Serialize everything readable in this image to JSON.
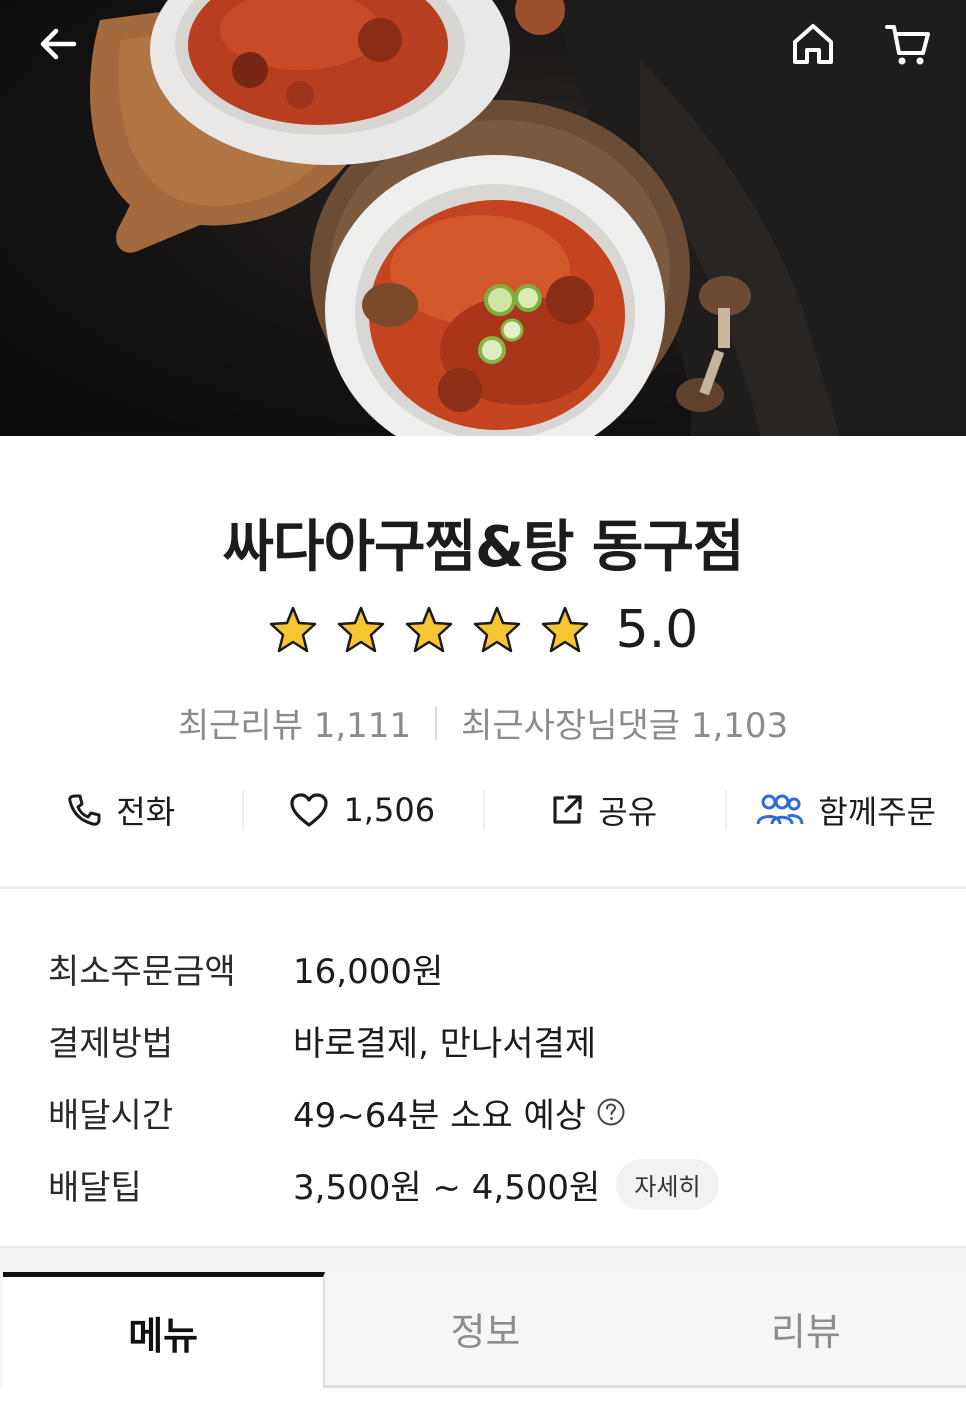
{
  "header": {
    "back_icon": "arrow-left-icon",
    "home_icon": "home-icon",
    "cart_icon": "cart-icon"
  },
  "store": {
    "name": "싸다아구찜&탕 동구점",
    "rating": "5.0",
    "star_count": 5,
    "recent_reviews_label": "최근리뷰 1,111",
    "owner_replies_label": "최근사장님댓글 1,103"
  },
  "actions": {
    "call": {
      "label": "전화",
      "icon": "phone-icon"
    },
    "like": {
      "label": "1,506",
      "icon": "heart-icon"
    },
    "share": {
      "label": "공유",
      "icon": "share-icon"
    },
    "group_order": {
      "label": "함께주문",
      "icon": "people-icon",
      "color": "#2f6bd8"
    }
  },
  "details": [
    {
      "label": "최소주문금액",
      "value": "16,000원"
    },
    {
      "label": "결제방법",
      "value": "바로결제, 만나서결제"
    },
    {
      "label": "배달시간",
      "value": "49~64분 소요 예상"
    },
    {
      "label": "배달팁",
      "value": "3,500원 ~ 4,500원",
      "chip": "자세히"
    }
  ],
  "tabs": [
    {
      "label": "메뉴",
      "active": true
    },
    {
      "label": "정보",
      "active": false
    },
    {
      "label": "리뷰",
      "active": false
    }
  ],
  "colors": {
    "star": "#f7c531",
    "accent": "#2f6bd8"
  }
}
